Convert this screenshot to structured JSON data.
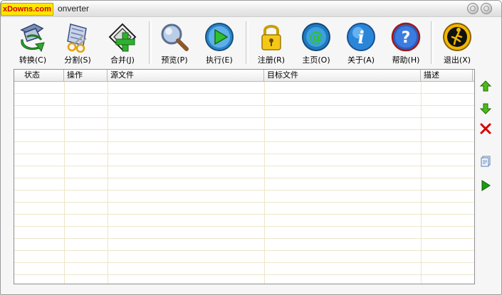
{
  "window": {
    "title_visible": "onverter",
    "watermark": "xDowns.com"
  },
  "toolbar": {
    "items": [
      {
        "label": "转换(C)",
        "icon": "convert-icon"
      },
      {
        "label": "分割(S)",
        "icon": "split-icon"
      },
      {
        "label": "合并(J)",
        "icon": "merge-icon"
      },
      {
        "label": "预览(P)",
        "icon": "magnifier-icon"
      },
      {
        "label": "执行(E)",
        "icon": "play-icon"
      },
      {
        "label": "注册(R)",
        "icon": "padlock-icon"
      },
      {
        "label": "主页(O)",
        "icon": "at-sign-icon"
      },
      {
        "label": "关于(A)",
        "icon": "info-icon"
      },
      {
        "label": "帮助(H)",
        "icon": "help-icon"
      },
      {
        "label": "退出(X)",
        "icon": "exit-icon"
      }
    ]
  },
  "table": {
    "columns": [
      "状态",
      "操作",
      "源文件",
      "目标文件",
      "描述"
    ],
    "rows": []
  },
  "side_buttons": [
    {
      "icon": "arrow-up-icon",
      "color": "#3aa000"
    },
    {
      "icon": "arrow-down-icon",
      "color": "#3aa000"
    },
    {
      "icon": "delete-x-icon",
      "color": "#d40000"
    },
    {
      "icon": "document-icon",
      "color": "#5a7fb0"
    },
    {
      "icon": "play-small-icon",
      "color": "#1e9a10"
    }
  ]
}
